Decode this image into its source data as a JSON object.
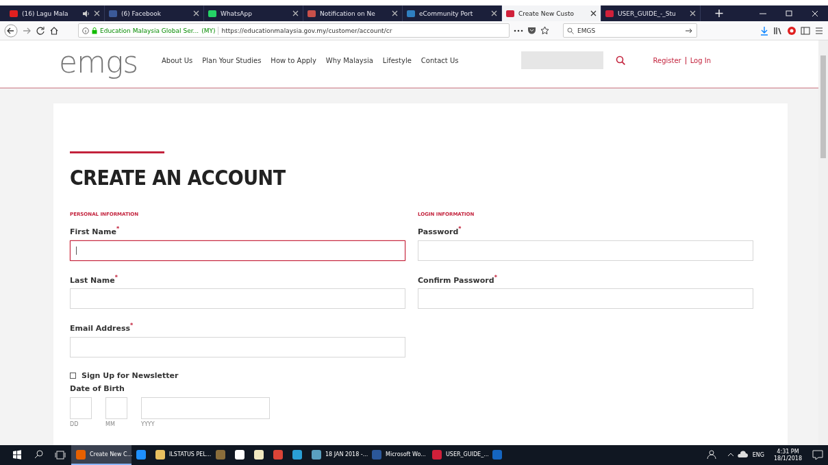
{
  "browser": {
    "tabs": [
      {
        "title": "(16) Lagu Mala",
        "selected": false,
        "audio": true,
        "color": "#e02020"
      },
      {
        "title": "(6) Facebook",
        "selected": false,
        "audio": false,
        "color": "#3b5998"
      },
      {
        "title": "WhatsApp",
        "selected": false,
        "audio": false,
        "color": "#25d366"
      },
      {
        "title": "Notification on Ne",
        "selected": false,
        "audio": false,
        "color": "#c8504a"
      },
      {
        "title": "eCommunity Port",
        "selected": false,
        "audio": false,
        "color": "#2f7fc0"
      },
      {
        "title": "Create New Custo",
        "selected": true,
        "audio": false,
        "color": "#d0203a"
      },
      {
        "title": "USER_GUIDE_-_Stu",
        "selected": false,
        "audio": false,
        "color": "#d0203a"
      }
    ],
    "address_bar": {
      "site_identity": "Education Malaysia Global Ser...",
      "country": "(MY)",
      "url": "https://educationmalaysia.gov.my/customer/account/cr"
    },
    "search": {
      "value": "EMGS"
    }
  },
  "site": {
    "logo": "emgs",
    "nav": [
      "About Us",
      "Plan Your Studies",
      "How to Apply",
      "Why Malaysia",
      "Lifestyle",
      "Contact Us"
    ],
    "account_links": [
      "Register",
      "Log In"
    ]
  },
  "form": {
    "title": "CREATE AN ACCOUNT",
    "columns": [
      {
        "heading": "PERSONAL INFORMATION",
        "fields": [
          {
            "kind": "text",
            "label": "First Name$^{*}$",
            "focused": true
          },
          {
            "kind": "text",
            "label": "Last Name$^{*}$",
            "focused": false
          },
          {
            "kind": "text",
            "label": "Email Address$^{*}$",
            "focused": false
          },
          {
            "kind": "checkbox",
            "label": "Sign Up for Newsletter",
            "checked": false
          },
          {
            "kind": "date",
            "label": "Date of Birth",
            "parts": [
              "DD",
              "MM",
              "YYYY"
            ]
          }
        ]
      },
      {
        "heading": "LOGIN INFORMATION",
        "fields": [
          {
            "kind": "password",
            "label": "Password$^{*}$",
            "focused": false
          },
          {
            "kind": "password",
            "label": "Confirm Password$^{*}$",
            "focused": false
          }
        ]
      }
    ]
  },
  "taskbar": {
    "apps": [
      {
        "kind": "window",
        "label": "Create New C...",
        "selected": true,
        "color": "#e66000"
      },
      {
        "kind": "pinned",
        "selected": false,
        "color": "#1e90ff"
      },
      {
        "kind": "window",
        "label": "ILSTATUS PEL...",
        "selected": false,
        "color": "#e8c060"
      },
      {
        "kind": "pinned",
        "selected": false,
        "color": "#8a6d3b"
      },
      {
        "kind": "pinned",
        "selected": false,
        "color": "#ffffff"
      },
      {
        "kind": "pinned",
        "selected": false,
        "color": "#f0e8c0"
      },
      {
        "kind": "pinned",
        "selected": false,
        "color": "#db4437"
      },
      {
        "kind": "pinned",
        "selected": false,
        "color": "#2a9fd6"
      },
      {
        "kind": "window",
        "label": "18 JAN 2018 -...",
        "selected": false,
        "color": "#5aa0c0"
      },
      {
        "kind": "window",
        "label": "Microsoft Wo...",
        "selected": false,
        "color": "#2b579a"
      },
      {
        "kind": "window",
        "label": "USER_GUIDE_...",
        "selected": false,
        "color": "#d0203a"
      },
      {
        "kind": "pinned",
        "selected": false,
        "color": "#1565c0"
      }
    ],
    "language": "ENG",
    "time": "4:31 PM",
    "date": "18/1/2018"
  }
}
